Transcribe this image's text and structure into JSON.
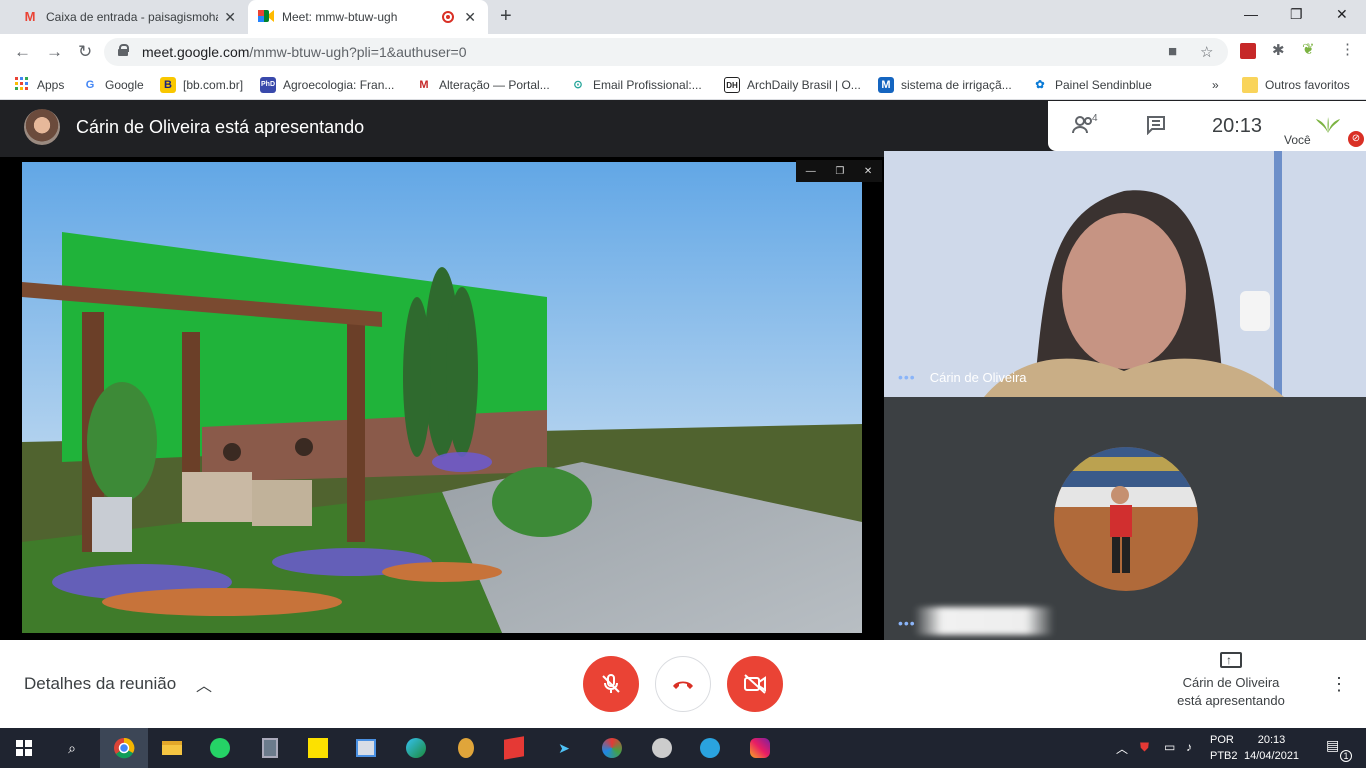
{
  "browser": {
    "tabs": [
      {
        "title": "Caixa de entrada - paisagismoha",
        "icon": "gmail-icon"
      },
      {
        "title": "Meet: mmw-btuw-ugh",
        "icon": "meet-icon",
        "active": true
      }
    ],
    "new_tab": "+",
    "window_controls": {
      "minimize": "—",
      "maximize": "❐",
      "close": "✕"
    },
    "url_domain": "meet.google.com",
    "url_path": "/mmw-btuw-ugh?pli=1&authuser=0"
  },
  "bookmarks": [
    {
      "label": "Apps",
      "icon": "apps-grid-icon",
      "color": "#1a73e8"
    },
    {
      "label": "Google",
      "icon": "google-icon",
      "color": "#4285f4"
    },
    {
      "label": "[bb.com.br]",
      "icon": "bb-icon",
      "color": "#f9c700"
    },
    {
      "label": "Agroecologia: Fran...",
      "icon": "phd-icon",
      "color": "#3949ab"
    },
    {
      "label": "Alteração — Portal...",
      "icon": "m-icon",
      "color": "#c62828"
    },
    {
      "label": "Email Profissional:...",
      "icon": "email-icon",
      "color": "#26a69a"
    },
    {
      "label": "ArchDaily Brasil | O...",
      "icon": "archdaily-icon",
      "color": "#222222"
    },
    {
      "label": "sistema de irrigaçã...",
      "icon": "irrigation-icon",
      "color": "#1565c0"
    },
    {
      "label": "Painel Sendinblue",
      "icon": "sendinblue-icon",
      "color": "#0b7bd6"
    }
  ],
  "bookmarks_more": "»",
  "bookmarks_other": "Outros favoritos",
  "meet": {
    "presenter_banner": "Cárin de Oliveira está apresentando",
    "participants_count": "4",
    "clock": "20:13",
    "you_label": "Você",
    "tile1_name": "Cárin de Oliveira",
    "details_label": "Detalhes da reunião",
    "presenting_line1": "Cárin de Oliveira",
    "presenting_line2": "está apresentando"
  },
  "taskbar": {
    "lang1": "POR",
    "lang2": "PTB2",
    "time": "20:13",
    "date": "14/04/2021",
    "notifications": "1"
  },
  "colors": {
    "meet_red": "#ea4335",
    "meet_dark": "#202124",
    "accent_blue": "#8ab4f8"
  }
}
